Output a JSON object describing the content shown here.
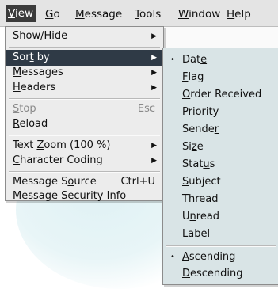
{
  "menubar": [
    {
      "pre": "",
      "acc": "V",
      "post": "iew",
      "open": true
    },
    {
      "pre": "",
      "acc": "G",
      "post": "o",
      "open": false
    },
    {
      "pre": "",
      "acc": "M",
      "post": "essage",
      "open": false
    },
    {
      "pre": "",
      "acc": "T",
      "post": "ools",
      "open": false
    },
    {
      "pre": "",
      "acc": "W",
      "post": "indow",
      "open": false
    },
    {
      "pre": "",
      "acc": "H",
      "post": "elp",
      "open": false
    }
  ],
  "view_menu": {
    "items": [
      {
        "pre": "Show",
        "acc": "/",
        "post": "Hide",
        "submenu": true
      },
      {
        "pre": "Sor",
        "acc": "t",
        "post": " by",
        "submenu": true,
        "selected": true
      },
      {
        "pre": "",
        "acc": "M",
        "post": "essages",
        "submenu": true
      },
      {
        "pre": "",
        "acc": "H",
        "post": "eaders",
        "submenu": true
      },
      {
        "pre": "",
        "acc": "S",
        "post": "top",
        "shortcut": "Esc",
        "disabled": true
      },
      {
        "pre": "",
        "acc": "R",
        "post": "eload"
      },
      {
        "pre": "Text ",
        "acc": "Z",
        "post": "oom (100 %)",
        "submenu": true
      },
      {
        "pre": "",
        "acc": "C",
        "post": "haracter Coding",
        "submenu": true
      },
      {
        "pre": "Message S",
        "acc": "o",
        "post": "urce",
        "shortcut": "Ctrl+U"
      },
      {
        "pre": "Message Security ",
        "acc": "I",
        "post": "nfo"
      }
    ]
  },
  "sort_menu": {
    "items": [
      {
        "pre": "Dat",
        "acc": "e",
        "post": "",
        "checked": true
      },
      {
        "pre": "",
        "acc": "F",
        "post": "lag"
      },
      {
        "pre": "",
        "acc": "O",
        "post": "rder Received"
      },
      {
        "pre": "",
        "acc": "P",
        "post": "riority"
      },
      {
        "pre": "Sende",
        "acc": "r",
        "post": ""
      },
      {
        "pre": "Si",
        "acc": "z",
        "post": "e"
      },
      {
        "pre": "Stat",
        "acc": "u",
        "post": "s"
      },
      {
        "pre": "",
        "acc": "S",
        "post": "ubject"
      },
      {
        "pre": "",
        "acc": "T",
        "post": "hread"
      },
      {
        "pre": "U",
        "acc": "n",
        "post": "read"
      },
      {
        "pre": "",
        "acc": "L",
        "post": "abel"
      },
      {
        "pre": "",
        "acc": "A",
        "post": "scending",
        "checked": true
      },
      {
        "pre": "",
        "acc": "D",
        "post": "escending"
      }
    ],
    "bullet": "•"
  },
  "icons": {
    "submenu_arrow": "▶"
  }
}
